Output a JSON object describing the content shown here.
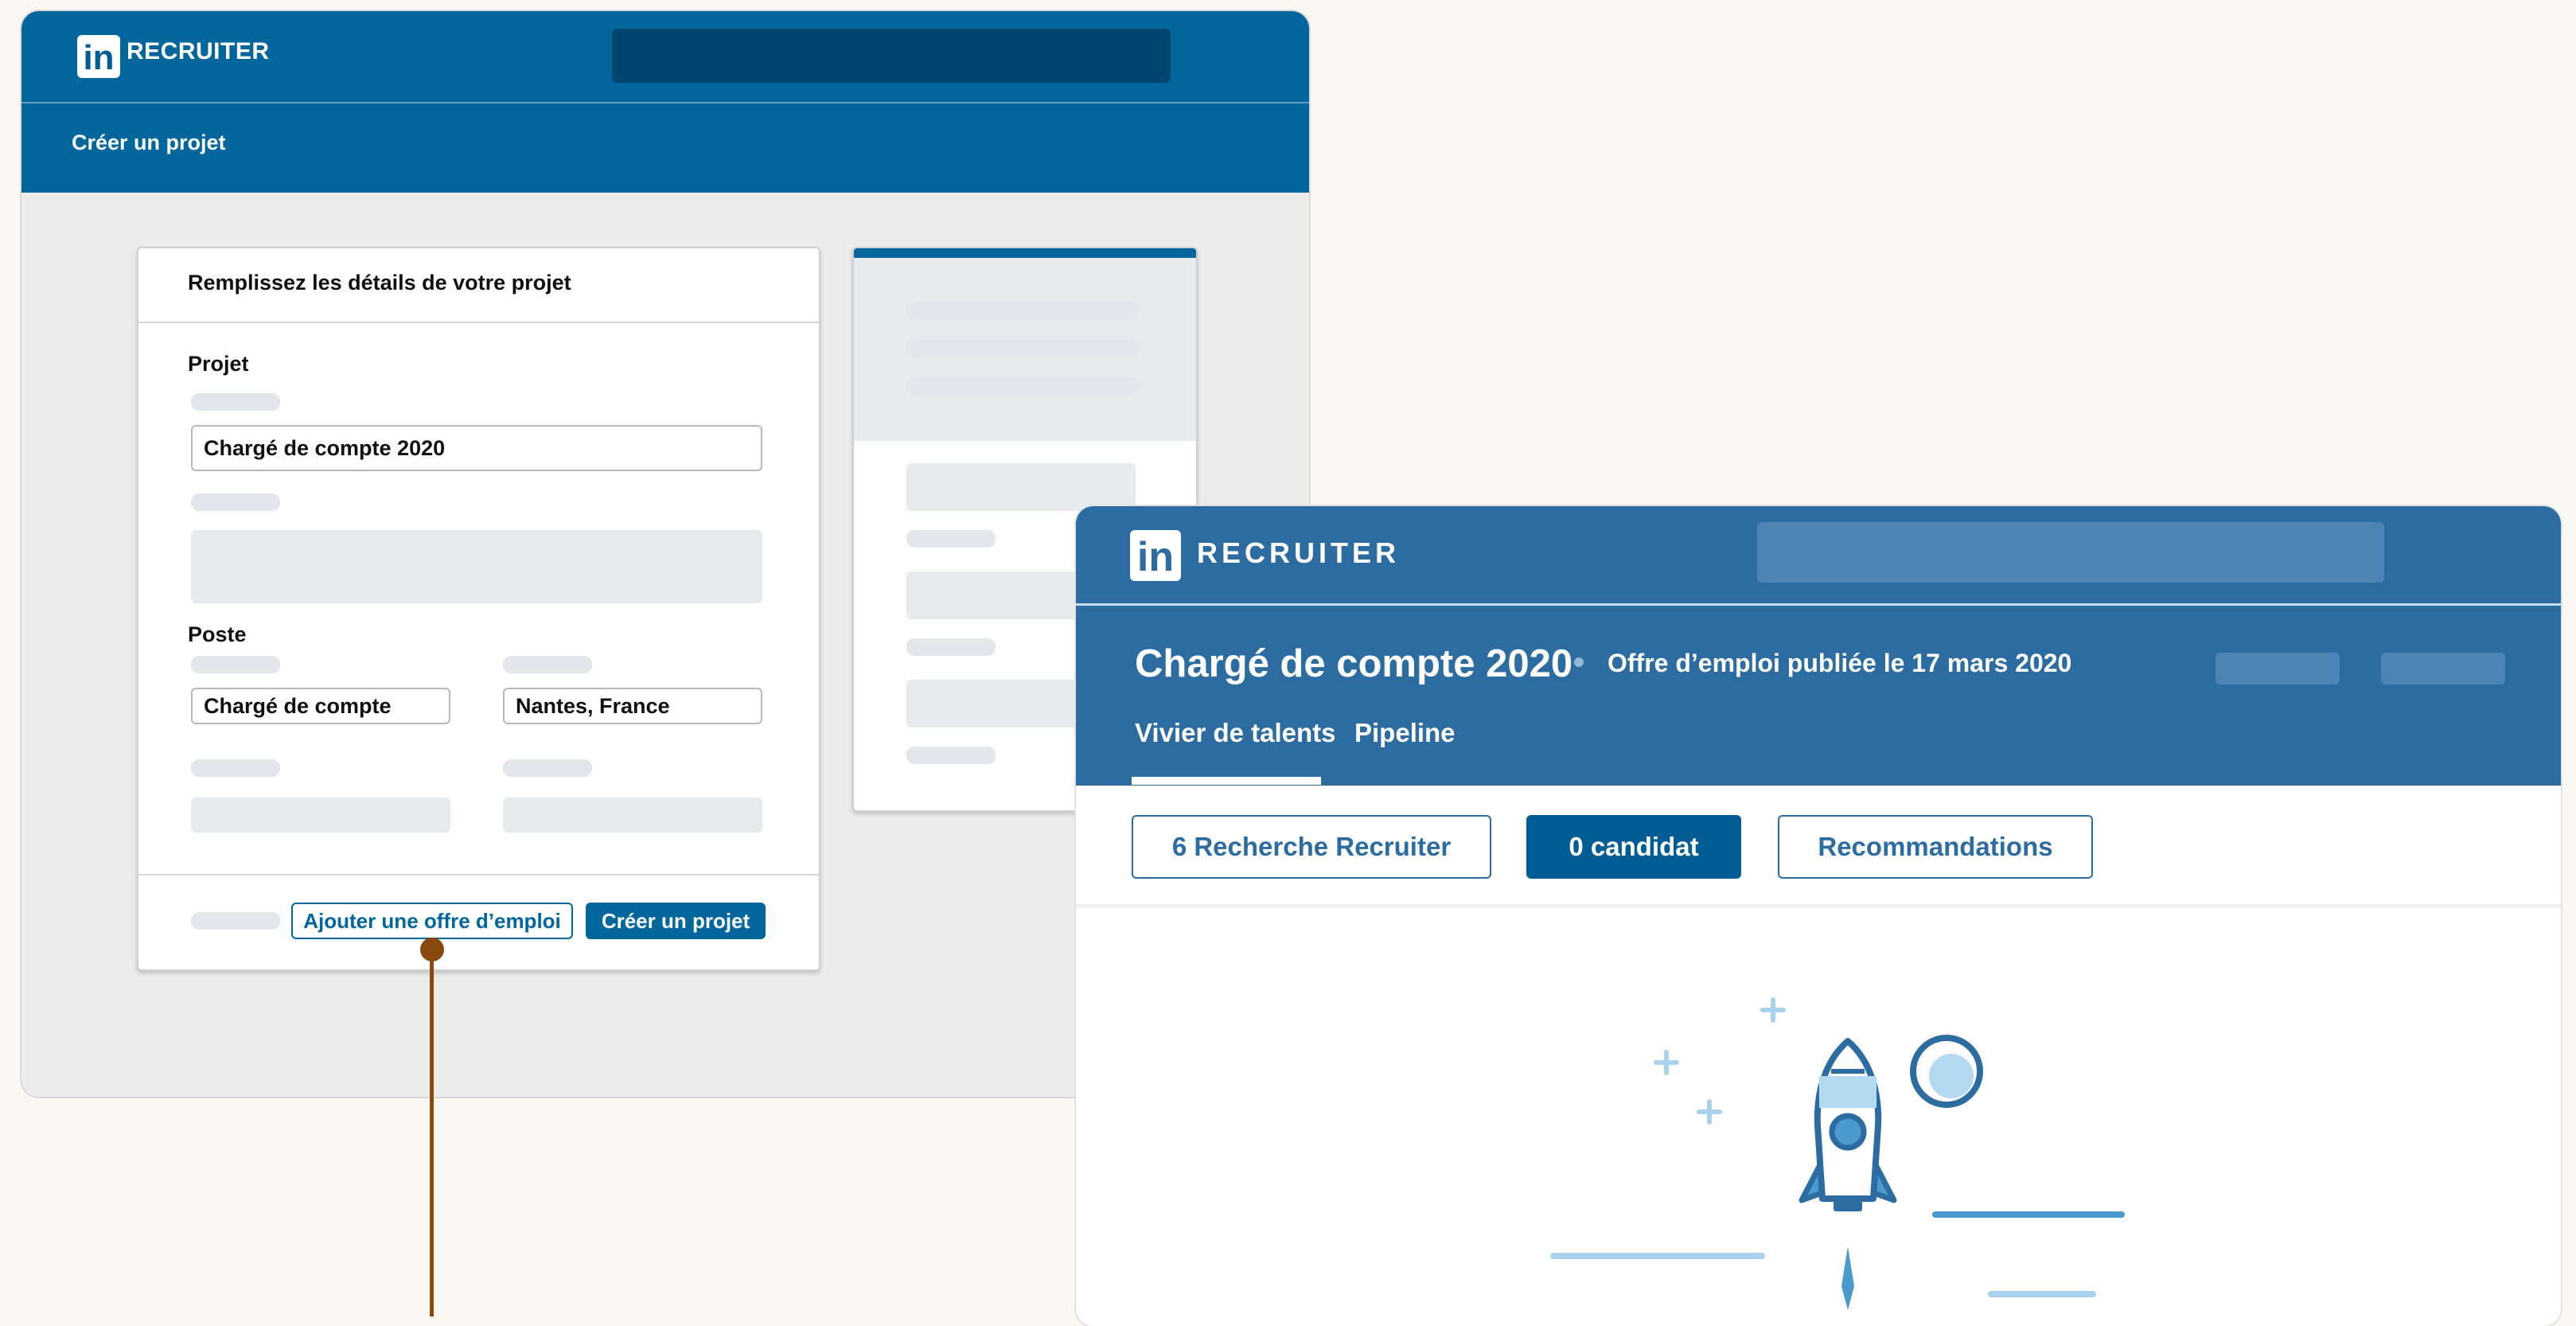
{
  "left_window": {
    "brand": "RECRUITER",
    "logo_text": "in",
    "subheader_title": "Créer un projet",
    "form": {
      "title": "Remplissez les détails de votre projet",
      "section_project": "Projet",
      "project_name_value": "Chargé de compte 2020",
      "section_position": "Poste",
      "position_value": "Chargé de compte",
      "location_value": "Nantes, France",
      "add_job_button": "Ajouter une offre d’emploi",
      "create_project_button": "Créer un projet"
    }
  },
  "right_window": {
    "brand": "RECRUITER",
    "logo_text": "in",
    "job_title": "Chargé de compte 2020",
    "job_subtitle": "Offre d’emploi publiée le 17 mars 2020",
    "tabs": [
      "Vivier de talents",
      "Pipeline"
    ],
    "active_tab": "Vivier de talents",
    "actions": {
      "recruiter_search": "6 Recherche Recruiter",
      "candidates": "0 candidat",
      "recommendations": "Recommandations"
    },
    "illustration": "rocket-launch-illustration"
  },
  "colors": {
    "left_brand_blue": "#00669c",
    "right_brand_blue": "#2d6ca0",
    "connector": "#8a4a0e",
    "background": "#fbf8f3"
  }
}
